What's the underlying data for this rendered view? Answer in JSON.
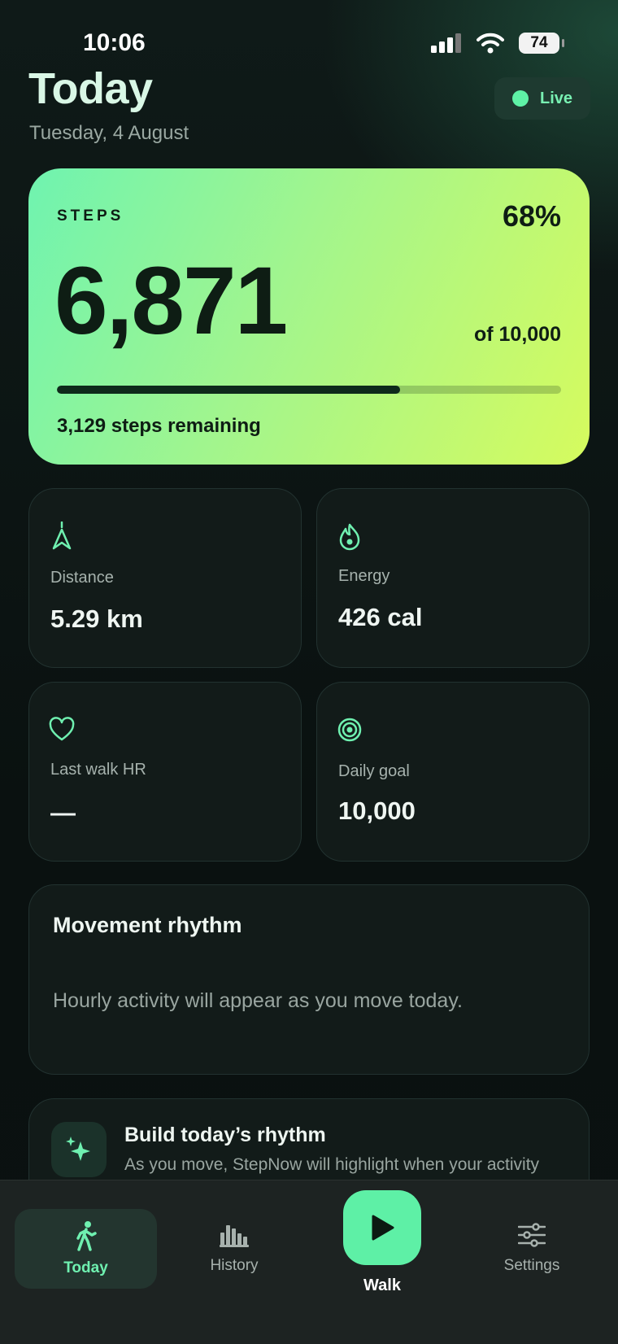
{
  "status_bar": {
    "time": "10:06",
    "battery": "74"
  },
  "header": {
    "title": "Today",
    "date": "Tuesday, 4 August",
    "live_label": "Live"
  },
  "steps_card": {
    "label": "STEPS",
    "percent": "68%",
    "progress": 0.68,
    "value": "6,871",
    "goal": "of 10,000",
    "remaining": "3,129 steps remaining"
  },
  "stats": [
    {
      "label": "Distance",
      "value": "5.29 km",
      "icon": "distance-icon"
    },
    {
      "label": "Energy",
      "value": "426 cal",
      "icon": "flame-icon"
    },
    {
      "label": "Last walk HR",
      "value": "—",
      "icon": "heart-icon"
    },
    {
      "label": "Daily goal",
      "value": "10,000",
      "icon": "target-icon"
    }
  ],
  "rhythm": {
    "title": "Movement rhythm",
    "empty_text": "Hourly activity will appear as you move today."
  },
  "insight": {
    "title": "Build today’s rhythm",
    "text": "As you move, StepNow will highlight when your activity hits",
    "icon": "sparkle-icon"
  },
  "nav": {
    "today": "Today",
    "history": "History",
    "walk": "Walk",
    "settings": "Settings"
  },
  "colors": {
    "accent": "#5ef0a6",
    "hero_start": "#6ff3b0",
    "hero_end": "#d6fb5e",
    "background": "#0b1211"
  }
}
